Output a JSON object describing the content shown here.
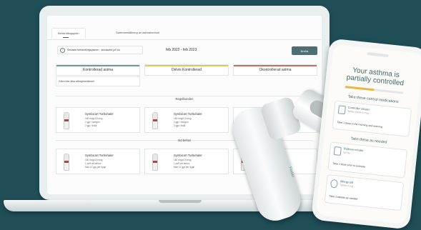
{
  "tabs": [
    "Behandlingsplan",
    "Sammanställning av astmakontroll"
  ],
  "info_notice": "Senaste behandlingsplanen · skickades juli nu",
  "period": "feb 2022 - feb 2023",
  "change_button": "Ändra",
  "status_cards": [
    {
      "label": "Kontrollerad astma",
      "color": "#6e9c92"
    },
    {
      "label": "Delvis Kontrollerad",
      "color": "#e8c35a"
    },
    {
      "label": "Okontrollerad astma",
      "color": "#cf6a5c"
    }
  ],
  "allergy_text": "Glöm inte dina allergimediciner!",
  "sections": {
    "regular": "Regelbunden",
    "as_needed": "Vid behov"
  },
  "regular_meds": [
    {
      "name": "Symbicort Turbuhaler",
      "lines": [
        "160 mcg/4,5 mcg",
        "2 ggr i morgon",
        "2 ggr i kväll"
      ]
    },
    {
      "name": "Symbicort Turbuhaler",
      "lines": [
        "160 mcg/4,5 mcg",
        "2 ggr i morgon",
        "2 ggr i kväll"
      ]
    },
    {
      "name": "",
      "lines": []
    }
  ],
  "as_needed_meds": [
    {
      "name": "Symbicort Turbuhaler",
      "lines": [
        "160 mcg/4,5 mcg",
        "1 puff vid behov",
        "Max 12 ggr per dygn"
      ]
    },
    {
      "name": "Symbicort Turbuhaler",
      "lines": [
        "160 mcg/4,5 mcg",
        "1 puff vid behov",
        "Max 12 ggr per dygn"
      ]
    },
    {
      "name": "",
      "lines": []
    }
  ],
  "phone": {
    "title_line1": "Your asthma is",
    "title_line2": "partially controlled",
    "control_level": 0.5,
    "section1": "Take these control medications",
    "controller": {
      "name": "Controller inhaler",
      "dose": "Spray 160/4.5 mcg",
      "note": "Take 1 dose in the morning and evening"
    },
    "section2": "Take these as needed",
    "reliever": {
      "name": "Reliever inhaler",
      "dose": "Spray",
      "note": "Take 1 dose prior to exercise"
    },
    "allergy": {
      "name": "Allergy pill",
      "dose": "Tablet 4 mg",
      "note": "Take 2 tablets as needed"
    }
  },
  "inhaler_brand": "Findair"
}
